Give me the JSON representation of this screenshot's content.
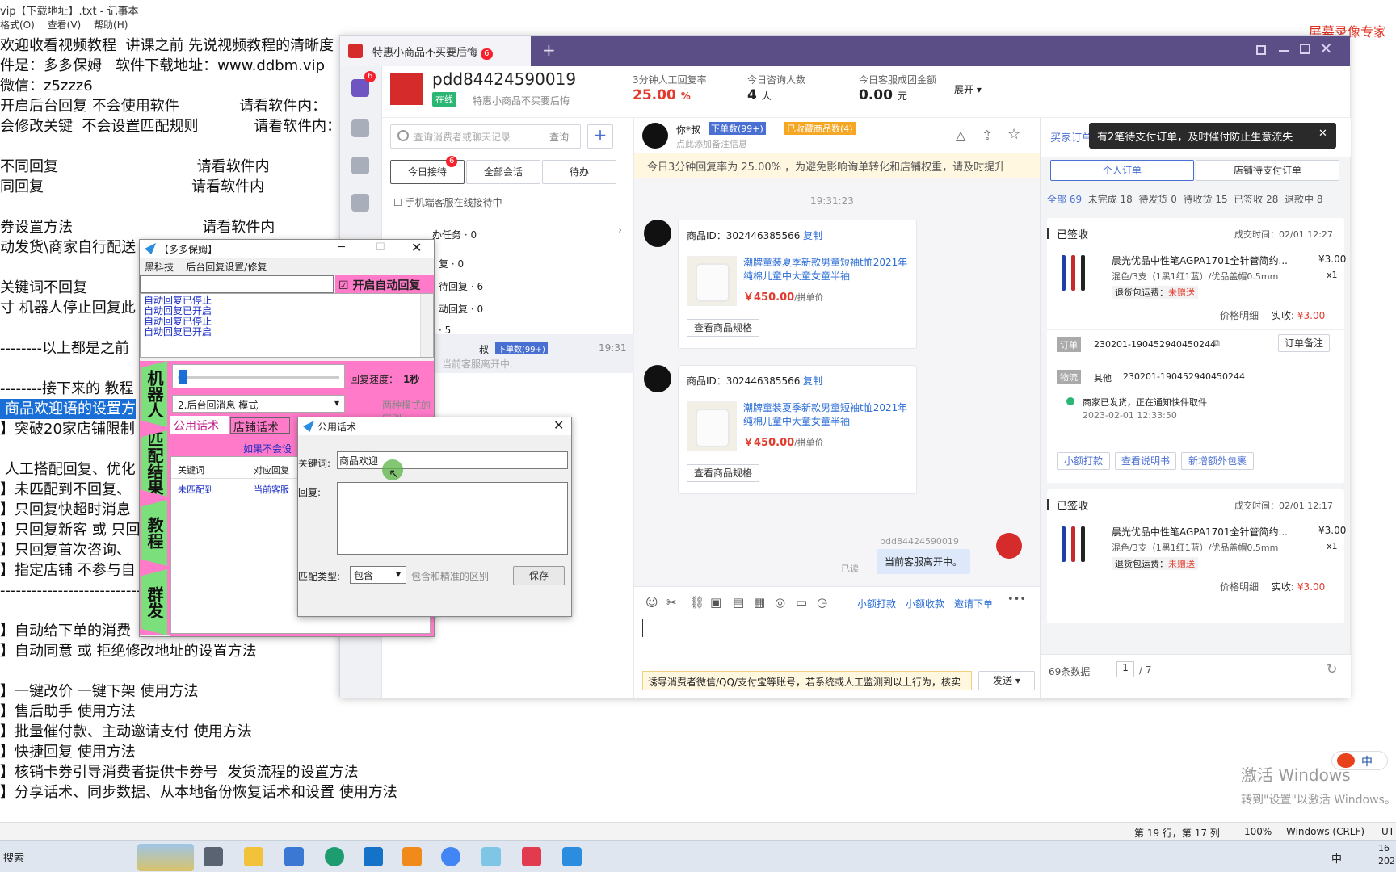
{
  "notepad": {
    "title": "vip【下载地址】.txt - 记事本",
    "menu": [
      "格式(O)",
      "查看(V)",
      "帮助(H)"
    ],
    "lines": [
      "欢迎收看视频教程  讲课之前 先说视频教程的清晰度",
      "件是：多多保姆   软件下载地址：www.ddbm.vip",
      "微信：z5zzz6",
      "开启后台回复 不会使用软件             请看软件内：",
      "会修改关键  不会设置匹配规则            请看软件内：",
      "",
      "不同回复                              请看软件内",
      "同回复                                请看软件内",
      "",
      "券设置方法                            请看软件内",
      "动发货\\商家自行配送",
      "",
      "关键词不回复",
      "寸 机器人停止回复此",
      "",
      "--------以上都是之前",
      "",
      "--------接下来的 教程",
      "商品欢迎语的设置方",
      "】突破20家店铺限制",
      "",
      " 人工搭配回复、优化",
      "】未匹配到不回复、",
      "】只回复快超时消息",
      "】只回复新客 或 只回",
      "】只回复首次咨询、",
      "】指定店铺 不参与自",
      "---------------------------",
      "",
      "】自动给下单的消费",
      "】自动同意 或 拒绝修改地址的设置方法",
      "",
      "】一键改价 一键下架 使用方法",
      "】售后助手 使用方法",
      "】批量催付款、主动邀请支付 使用方法",
      "】快捷回复 使用方法",
      "】核销卡券引导消费者提供卡券号  发货流程的设置方法",
      "】分享话术、同步数据、从本地备份恢复话术和设置 使用方法"
    ],
    "highlight_line": "商品欢迎语的设置方",
    "status": {
      "position": "第 19 行，第 17 列",
      "zoom": "100%",
      "eol": "Windows (CRLF)",
      "enc": "UT"
    }
  },
  "overlay": {
    "recorder": "屏幕录像专家",
    "activate_title": "激活 Windows",
    "activate_sub": "转到\"设置\"以激活 Windows。",
    "ime": "中"
  },
  "taskbar": {
    "search": "搜索",
    "tray_lang": "中",
    "clock": "16",
    "date": "202"
  },
  "chat": {
    "tab_title": "特惠小商品不买要后悔",
    "tab_badge": "6",
    "new_tab": "+",
    "shop_name": "pdd84424590019",
    "status": "在线",
    "shop_sub": "特惠小商品不买要后悔",
    "stats": [
      {
        "label": "3分钟人工回复率",
        "value": "25.00",
        "unit": "%"
      },
      {
        "label": "今日咨询人数",
        "value": "4",
        "unit": "人"
      },
      {
        "label": "今日客服成团金额",
        "value": "0.00",
        "unit": "元"
      }
    ],
    "expand": "展开",
    "search_placeholder": "查询消费者或聊天记录",
    "search_btn": "查询",
    "session_tabs": [
      "今日接待",
      "全部会话",
      "待办"
    ],
    "session_tab_badge": "6",
    "mobile_check": "手机端客服在线接待中",
    "task_rows": [
      "办任务 · 0",
      "复 · 0",
      "待回复 · 6",
      "动回复 · 0",
      "· 5"
    ],
    "session_item": {
      "name": "叔",
      "tag": "下单数(99+)",
      "time": "19:31",
      "preview": "当前客服离开中."
    },
    "left_badge": "6",
    "buyer_name": "你*叔",
    "buyer_tag1": "下单数(99+)",
    "buyer_tag2": "已收藏商品数(4)",
    "buyer_note": "点此添加备注信息",
    "warn_text": "今日3分钟回复率为 25.00% ，为避免影响询单转化和店铺权重，请及时提升",
    "time_divider": "19:31:23",
    "product_cards": [
      {
        "id_label": "商品ID：302446385566",
        "copy": "复制",
        "title": "潮牌童装夏季新款男童短袖t恤2021年纯棉儿童中大童女童半袖",
        "price": "￥450.00",
        "price_unit": "/拼单价",
        "spec_btn": "查看商品规格"
      },
      {
        "id_label": "商品ID：302446385566",
        "copy": "复制",
        "title": "潮牌童装夏季新款男童短袖t恤2021年纯棉儿童中大童女童半袖",
        "price": "￥450.00",
        "price_unit": "/拼单价",
        "spec_btn": "查看商品规格"
      }
    ],
    "self_name": "pdd84424590019",
    "self_msg": "当前客服离开中。",
    "self_read": "已读",
    "toolbar_links": [
      "小额打款",
      "小额收款",
      "邀请下单"
    ],
    "bottom_warn": "诱导消费者微信/QQ/支付宝等账号，若系统或人工监测到以上行为，核实",
    "send": "发送",
    "order_tab_label": "买家订单",
    "tooltip": "有2笔待支付订单，及时催付防止生意流失",
    "order_tabs": [
      "个人订单",
      "店铺待支付订单"
    ],
    "order_filters": [
      "全部 69",
      "未完成 18",
      "待发货 0",
      "待收货 15",
      "已签收 28",
      "退款中 8"
    ],
    "orders": [
      {
        "status": "已签收",
        "time": "成交时间：02/01 12:27",
        "title": "晨光优品中性笔AGPA1701全针管简约...",
        "price": "¥3.00",
        "spec": "混色/3支（1黑1红1蓝）/优品盖帽0.5mm",
        "qty": "x1",
        "refund": "退货包运费：",
        "refund_v": "未赠送",
        "detail": "价格明细",
        "paid_label": "实收:",
        "paid": "¥3.00"
      },
      {
        "status": "已签收",
        "time": "成交时间：02/01 12:17",
        "title": "晨光优品中性笔AGPA1701全针管简约...",
        "price": "¥3.00",
        "spec": "混色/3支（1黑1红1蓝）/优品盖帽0.5mm",
        "qty": "x1",
        "refund": "退货包运费：",
        "refund_v": "未赠送",
        "detail": "价格明细",
        "paid_label": "实收:",
        "paid": "¥3.00"
      }
    ],
    "order_no_label": "订单",
    "order_no": "230201-190452940450244",
    "order_note_btn": "订单备注",
    "logistics_label": "物流",
    "logistics_co": "其他",
    "logistics_no": "230201-190452940450244",
    "logistics_msg": "商家已发货，正在通知快件取件",
    "logistics_time": "2023-02-01 12:33:50",
    "order_btns": [
      "小额打款",
      "查看说明书",
      "新增额外包裹"
    ],
    "pager_total": "69条数据",
    "pager_page": "1",
    "pager_pages": "/ 7"
  },
  "robot": {
    "title": "【多多保姆】",
    "menu": [
      "黑科技",
      "后台回复设置/修复"
    ],
    "auto_reply": "开启自动回复",
    "log": [
      "自动回复已停止",
      "自动回复已开启",
      "自动回复已停止",
      "自动回复已开启"
    ],
    "speed_label": "回复速度：",
    "speed_value": "1秒",
    "mode_select": "2.后台回消息  模式",
    "mode_hint": "两种模式的区别",
    "side_tabs": [
      "机器人",
      "匹配结果",
      "教程",
      "群发"
    ],
    "sub_tabs": [
      "公用话术",
      "店铺话术"
    ],
    "pink_hint": "如果不会设",
    "table_headers": [
      "关键词",
      "对应回复"
    ],
    "table_row": [
      "未匹配到",
      "当前客服"
    ]
  },
  "dialog": {
    "title": "公用话术",
    "keyword_label": "关键词:",
    "keyword_value": "商品欢迎",
    "reply_label": "回复:",
    "match_label": "匹配类型:",
    "match_value": "包含",
    "match_hint": "包含和精准的区别",
    "save": "保存"
  },
  "colors": {
    "accent": "#5b4d86",
    "pink": "#ff7ac8",
    "green": "#7be07b",
    "red": "#e23b2e",
    "blue": "#2b6dd6"
  }
}
